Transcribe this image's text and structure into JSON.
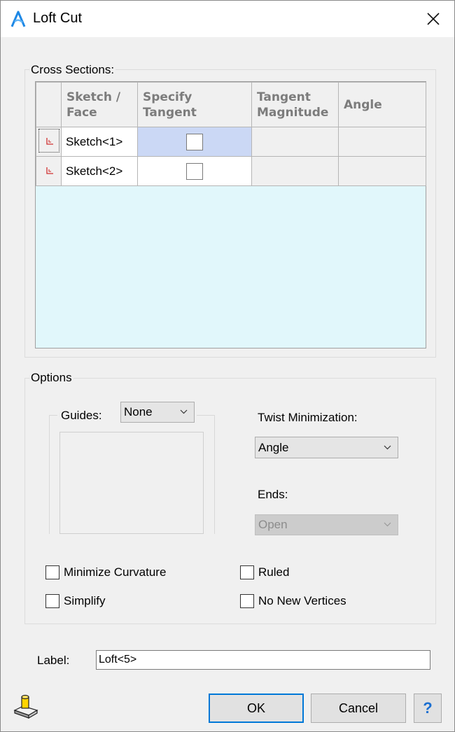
{
  "window": {
    "title": "Loft Cut"
  },
  "cross_sections": {
    "legend": "Cross Sections:",
    "columns": [
      "Sketch / Face",
      "Specify Tangent",
      "Tangent Magnitude",
      "Angle"
    ],
    "column_lines": [
      [
        "Sketch /",
        "Face"
      ],
      [
        "Specify",
        "Tangent"
      ],
      [
        "Tangent",
        "Magnitude"
      ],
      [
        "Angle"
      ]
    ],
    "rows": [
      {
        "sketch": "Sketch<1>",
        "specify_tangent": false,
        "tangent_magnitude": "",
        "angle": "",
        "selected": true
      },
      {
        "sketch": "Sketch<2>",
        "specify_tangent": false,
        "tangent_magnitude": "",
        "angle": "",
        "selected": false
      }
    ]
  },
  "options": {
    "legend": "Options",
    "guides_label": "Guides:",
    "guides_value": "None",
    "twist_label": "Twist Minimization:",
    "twist_value": "Angle",
    "ends_label": "Ends:",
    "ends_value": "Open",
    "checkboxes": {
      "minimize_curvature": {
        "label": "Minimize Curvature",
        "checked": false
      },
      "simplify": {
        "label": "Simplify",
        "checked": false
      },
      "ruled": {
        "label": "Ruled",
        "checked": false
      },
      "no_new_vertices": {
        "label": "No New Vertices",
        "checked": false
      }
    }
  },
  "label_field": {
    "label": "Label:",
    "value": "Loft<5>"
  },
  "buttons": {
    "ok": "OK",
    "cancel": "Cancel",
    "help": "?"
  },
  "colors": {
    "accent": "#0078d7",
    "grid_empty_area": "#e1f7fb",
    "selected_cell": "#cbd8f5",
    "sketch_icon": "#d03030"
  }
}
